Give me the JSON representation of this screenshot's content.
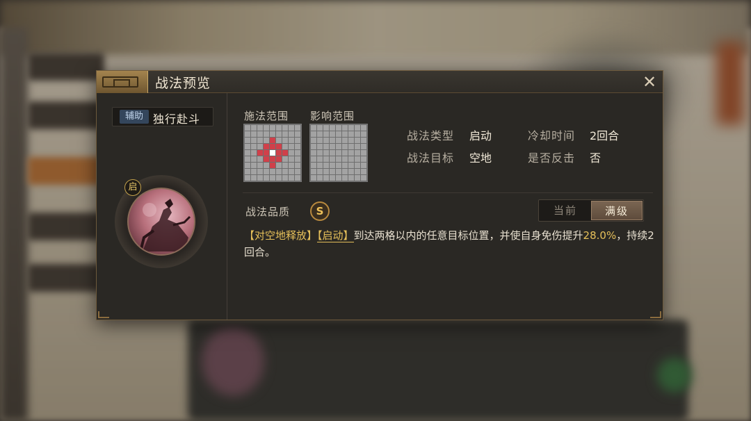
{
  "dialog": {
    "title": "战法预览",
    "close_symbol": "✕"
  },
  "skill": {
    "role_badge": "辅助",
    "name": "独行赴斗",
    "type_badge": "启"
  },
  "ranges": {
    "cast_label": "施法范围",
    "effect_label": "影响范围"
  },
  "info": {
    "type_label": "战法类型",
    "type_value": "启动",
    "cooldown_label": "冷却时间",
    "cooldown_value": "2回合",
    "target_label": "战法目标",
    "target_value": "空地",
    "counter_label": "是否反击",
    "counter_value": "否"
  },
  "quality": {
    "label": "战法品质",
    "grade": "S"
  },
  "level_toggle": {
    "current": "当前",
    "max": "满级"
  },
  "description": {
    "tag1": "【对空地释放】",
    "tag2": "【启动】",
    "text1": "到达两格以内的任意目标位置，并使自身免伤提升",
    "value": "28.0%",
    "text2": "，持续2回合。"
  },
  "colors": {
    "accent_gold": "#e6c05a",
    "grid_red": "#d0404a",
    "panel_bg": "#2a2824"
  },
  "icons": {
    "close": "close-icon",
    "type_badge": "start-icon"
  }
}
